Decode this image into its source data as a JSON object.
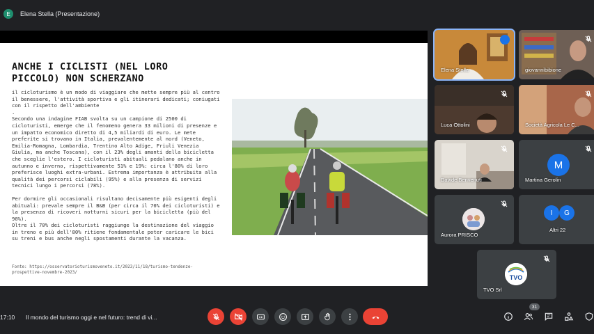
{
  "presenter_bar": {
    "avatar_letter": "E",
    "label": "Elena Stella (Presentazione)"
  },
  "slide": {
    "title": "ANCHE I CICLISTI (NEL LORO PICCOLO) NON SCHERZANO",
    "paragraphs": [
      "il cicloturismo è un modo di viaggiare che mette sempre più al centro il benessere, l'attività sportiva e gli itinerari dedicati; coniugati con il rispetto dell'ambiente",
      ".",
      "Secondo una indagine FIAB svolta su un campione di 2500 di cicloturisti, emerge che il fenomeno genera 33 milioni di presenze e un impatto economico diretto di 4,5 miliardi di euro. Le mete preferite si trovano in Italia, prevalentemente al nord (Veneto, Emilia-Romagna, Lombardia, Trentino Alto Adige, Friuli Venezia Giulia, ma anche Toscana), con il 23% degli amanti della bicicletta che sceglie l'estero. I cicloturisti abituali pedalano anche in autunno e inverno, rispettivamente 51% e 19%: circa l'80% di loro preferisce luoghi extra-urbani. Estrema importanza è attribuita alla qualità dei percorsi ciclabili (95%) e alla presenza di servizi tecnici lungo i percorsi (78%).",
      "",
      "Per dormire gli occasionali risultano decisamente più esigenti degli abituali: prevale sempre il B&B (per circa il 70% dei cicloturisti) e la presenza di ricoveri notturni sicuri per la bicicletta (più del 90%).",
      "Oltre il 70% dei cicloturisti raggiunge la destinazione del viaggio in treno e più dell'80% ritiene fondamentale poter caricare le bici su treni e bus anche negli spostamenti durante la vacanza."
    ],
    "source": "Fonte: https://osservatorioturismoveneto.it/2023/11/18/turismo-tendenze-prospettive-novembre-2023/"
  },
  "participants": [
    {
      "name": "Elena Stella",
      "status": "speaking"
    },
    {
      "name": "giovannibibione",
      "status": "muted"
    },
    {
      "name": "Luca Ottolini",
      "status": "muted"
    },
    {
      "name": "Società Agricola Le C...",
      "status": "muted"
    },
    {
      "name": "Davide Benvenuti",
      "status": "muted"
    },
    {
      "name": "Martina Gerolin",
      "status": "muted",
      "avatar_letter": "M"
    },
    {
      "name": "Aurora PRISCO",
      "status": "muted"
    },
    {
      "name": "Altri 22",
      "avatar_letters": [
        "I",
        "G"
      ]
    },
    {
      "name": "TVO Srl",
      "status": "muted",
      "logo_text": "TVO"
    }
  ],
  "bottom_bar": {
    "time": "17:10",
    "meeting_title": "Il mondo del turismo oggi e nel futuro: trend di vi...",
    "participant_count": "31"
  },
  "colors": {
    "background": "#202124",
    "tile": "#3c4043",
    "danger": "#ea4335",
    "accent_blue": "#1a73e8",
    "active_outline": "#8ab4f8"
  }
}
